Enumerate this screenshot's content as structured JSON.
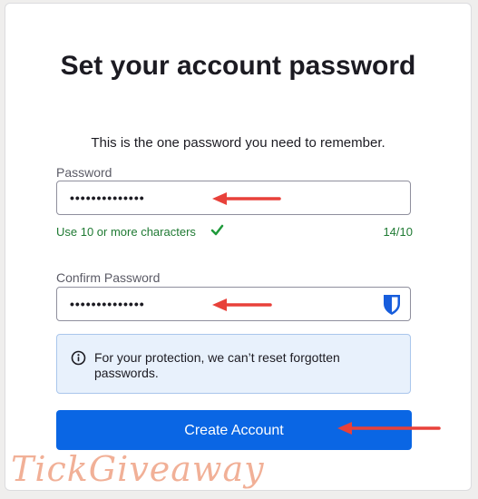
{
  "heading": {
    "title": "Set your account password",
    "subtitle": "This is the one password you need to remember."
  },
  "password_field": {
    "label": "Password",
    "value": "••••••••••••••"
  },
  "password_hint": {
    "text": "Use 10 or more characters",
    "count": "14/10",
    "status_color": "#1f7a33"
  },
  "confirm_field": {
    "label": "Confirm Password",
    "value": "••••••••••••••",
    "manager_icon": "bitwarden-shield-icon"
  },
  "notice": {
    "icon": "info-icon",
    "text": "For your protection, we can’t reset forgotten passwords."
  },
  "submit": {
    "label": "Create Account",
    "color": "#0a66e4"
  },
  "annotations": {
    "arrow_color": "#e8413a"
  },
  "watermark": {
    "text": "TickGiveaway"
  }
}
